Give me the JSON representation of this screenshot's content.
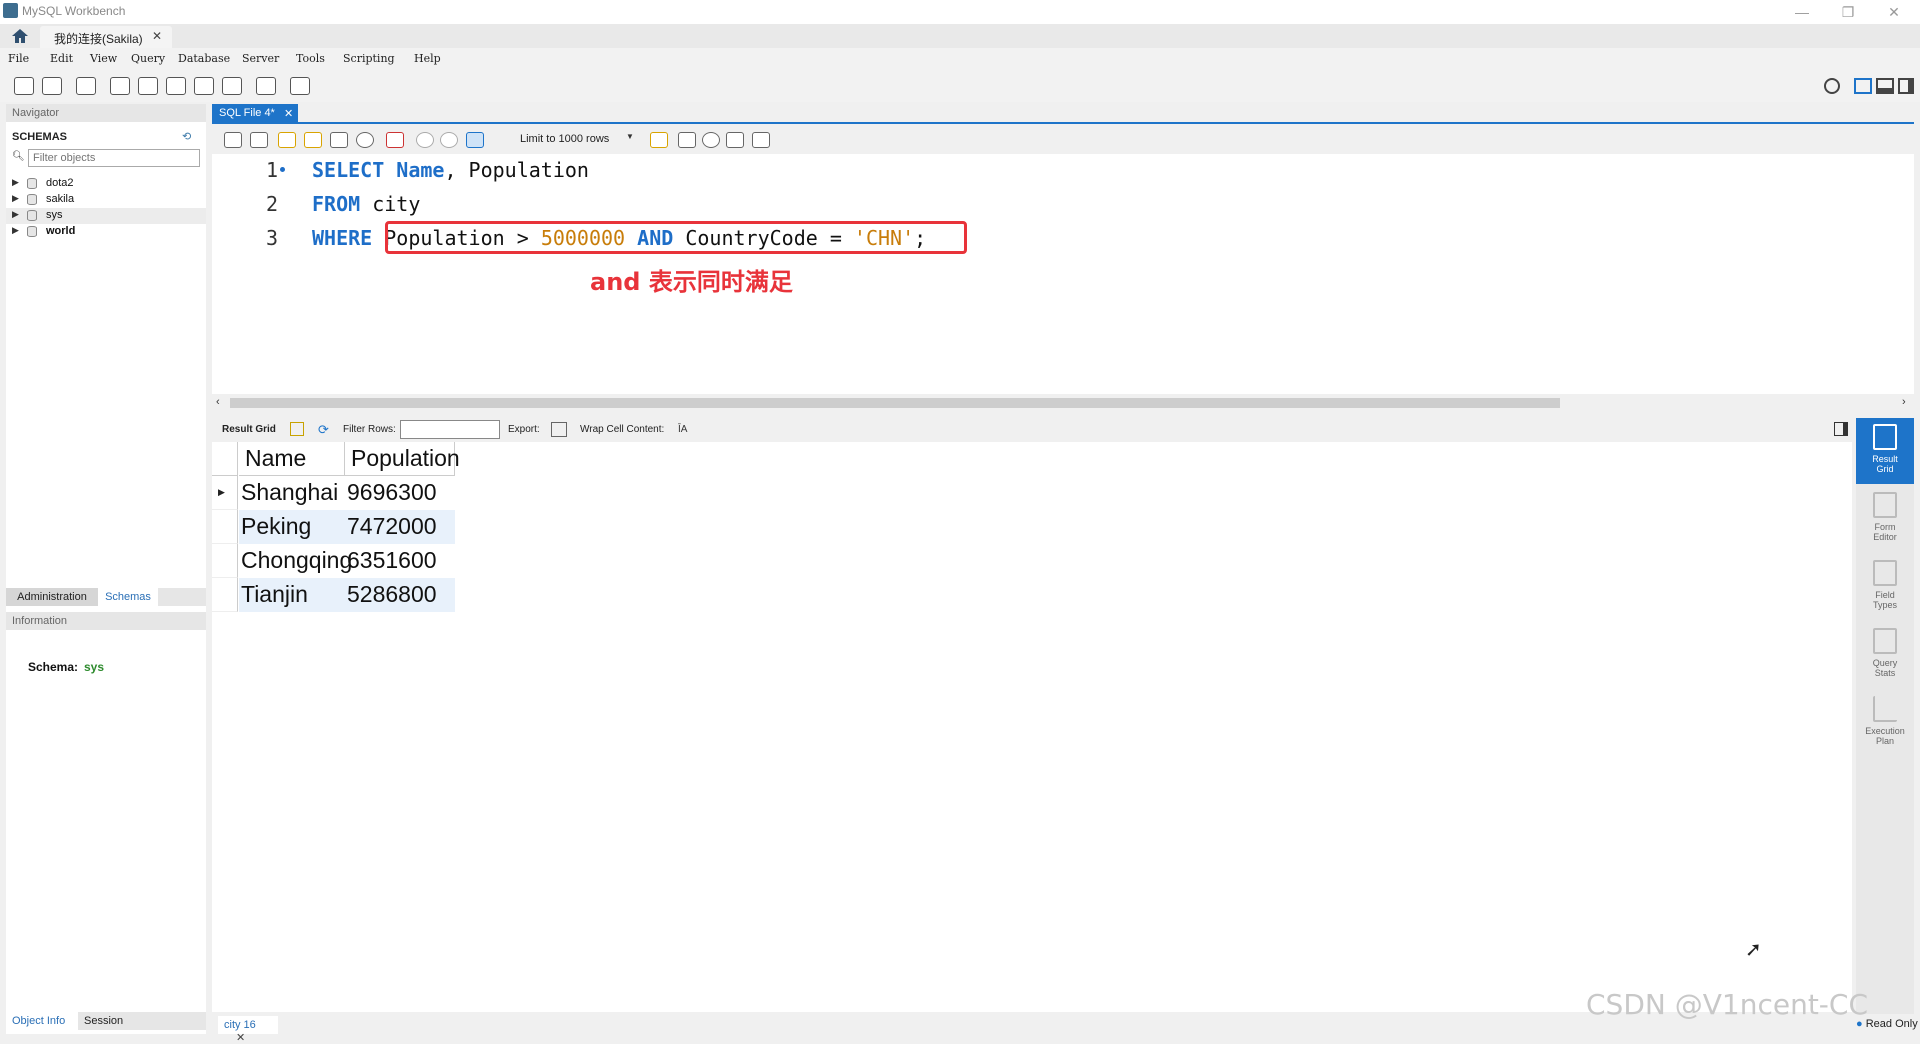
{
  "window": {
    "title": "MySQL Workbench"
  },
  "connection_tab": {
    "label": "我的连接(Sakila)",
    "close": "✕"
  },
  "menu": [
    "File",
    "Edit",
    "View",
    "Query",
    "Database",
    "Server",
    "Tools",
    "Scripting",
    "Help"
  ],
  "navigator": {
    "header": "Navigator",
    "schemas_title": "SCHEMAS",
    "filter_placeholder": "Filter objects",
    "schemas": [
      "dota2",
      "sakila",
      "sys",
      "world"
    ],
    "tabs": [
      "Administration",
      "Schemas"
    ],
    "info_header": "Information",
    "schema_label": "Schema:",
    "schema_value": "sys",
    "bottom_tabs": [
      "Object Info",
      "Session"
    ]
  },
  "sql_editor": {
    "tab_label": "SQL File 4*",
    "limit_label": "Limit to 1000 rows",
    "lines": [
      "1",
      "2",
      "3"
    ],
    "code": {
      "l1_kw": "SELECT",
      "l1_rest_a": "Name",
      "l1_rest_b": ", Population",
      "l2_kw": "FROM",
      "l2_rest": "city",
      "l3_kw": "WHERE",
      "l3_a": "Population > ",
      "l3_num": "5000000",
      "l3_and": "AND",
      "l3_b": " CountryCode = ",
      "l3_str": "'CHN'",
      "l3_end": ";"
    },
    "annotation": "and 表示同时满足"
  },
  "result_toolbar": {
    "result_grid": "Result Grid",
    "filter_rows": "Filter Rows:",
    "export": "Export:",
    "wrap": "Wrap Cell Content:"
  },
  "result_grid": {
    "columns": [
      "Name",
      "Population"
    ],
    "rows": [
      [
        "Shanghai",
        "9696300"
      ],
      [
        "Peking",
        "7472000"
      ],
      [
        "Chongqing",
        "6351600"
      ],
      [
        "Tianjin",
        "5286800"
      ]
    ]
  },
  "right_panel": [
    {
      "label_1": "Result",
      "label_2": "Grid"
    },
    {
      "label_1": "Form",
      "label_2": "Editor"
    },
    {
      "label_1": "Field",
      "label_2": "Types"
    },
    {
      "label_1": "Query",
      "label_2": "Stats"
    },
    {
      "label_1": "Execution",
      "label_2": "Plan"
    }
  ],
  "bottom": {
    "result_tab": "city 16",
    "status": "Read Only",
    "watermark": "CSDN @V1ncent-CC"
  },
  "colors": {
    "accent": "#1e74c9",
    "keyword": "#1e6ec8",
    "literal": "#c87d0a",
    "highlight": "#e8333a",
    "schema_value": "#2e8b2e"
  }
}
